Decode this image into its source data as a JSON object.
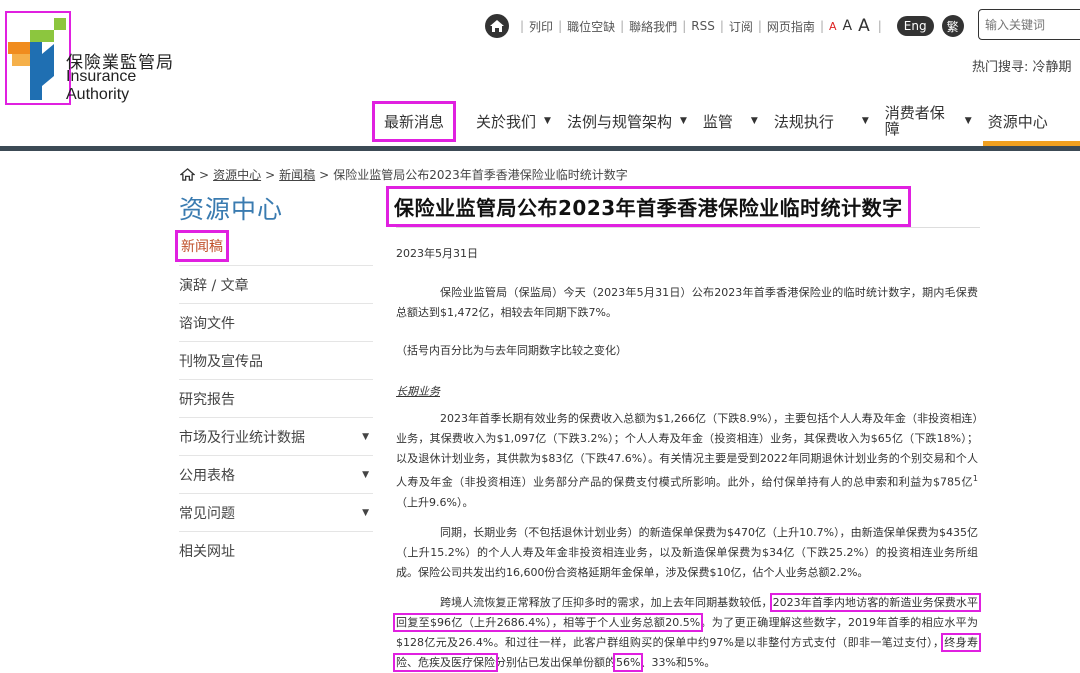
{
  "org": {
    "name_zh": "保險業監管局",
    "name_en": "Insurance Authority"
  },
  "topbar": {
    "links": [
      "列印",
      "職位空缺",
      "聯絡我們",
      "RSS",
      "订阅",
      "网页指南"
    ],
    "font_sizes": [
      "A",
      "A",
      "A"
    ],
    "lang_en": "Eng",
    "lang_trad": "繁",
    "search_placeholder": "输入关键词",
    "hot_search": "热门搜寻: 冷静期"
  },
  "nav": {
    "items": [
      {
        "label": "最新消息",
        "has_dropdown": false
      },
      {
        "label": "关於我们",
        "has_dropdown": true
      },
      {
        "label": "法例与规管架构",
        "has_dropdown": true
      },
      {
        "label": "监管",
        "has_dropdown": true
      },
      {
        "label": "法规执行",
        "has_dropdown": true
      },
      {
        "label": "消费者保障",
        "has_dropdown": true
      },
      {
        "label": "资源中心",
        "has_dropdown": false
      }
    ],
    "active": "资源中心"
  },
  "breadcrumb": {
    "items": [
      "资源中心",
      "新闻稿"
    ],
    "current": "保险业监管局公布2023年首季香港保险业临时统计数字"
  },
  "sidebar": {
    "title": "资源中心",
    "current": "新闻稿",
    "items": [
      {
        "label": "演辞 / 文章",
        "has_dropdown": false
      },
      {
        "label": "谘询文件",
        "has_dropdown": false
      },
      {
        "label": "刊物及宣传品",
        "has_dropdown": false
      },
      {
        "label": "研究报告",
        "has_dropdown": false
      },
      {
        "label": "市场及行业统计数据",
        "has_dropdown": true
      },
      {
        "label": "公用表格",
        "has_dropdown": true
      },
      {
        "label": "常见问题",
        "has_dropdown": true
      },
      {
        "label": "相关网址",
        "has_dropdown": false
      }
    ]
  },
  "article": {
    "title": "保险业监管局公布2023年首季香港保险业临时统计数字",
    "date": "2023年5月31日",
    "p1": "保险业监管局（保监局）今天（2023年5月31日）公布2023年首季香港保险业的临时统计数字，期内毛保费总额达到$1,472亿，相较去年同期下跌7%。",
    "p2": "（括号内百分比为与去年同期数字比较之变化）",
    "section_heading": "长期业务",
    "p3_a": "2023年首季长期有效业务的保费收入总额为$1,266亿（下跌8.9%），主要包括个人人寿及年金（非投资相连）业务，其保费收入为$1,097亿（下跌3.2%）；个人人寿及年金（投资相连）业务，其保费收入为$65亿（下跌18%）；以及退休计划业务，其供款为$83亿（下跌47.6%）。有关情况主要是受到2022年同期退休计划业务的个别交易和个人人寿及年金（非投资相连）业务部分产品的保费支付模式所影响。此外，给付保单持有人的总申索和利益为$785亿",
    "p3_sup": "1",
    "p3_b": "（上升9.6%）。",
    "p4": "同期，长期业务（不包括退休计划业务）的新造保单保费为$470亿（上升10.7%），由新造保单保费为$435亿（上升15.2%）的个人人寿及年金非投资相连业务，以及新造保单保费为$34亿（下跌25.2%）的投资相连业务所组成。保险公司共发出约16,600份合资格延期年金保单，涉及保费$10亿，佔个人业务总额2.2%。",
    "p5_a": "跨境人流恢复正常释放了压抑多时的需求，加上去年同期基数较低，",
    "p5_m1": "2023年首季内地访客的新造业务保费水平回复至$96亿（上升2686.4%），相等于个人业务总额20.5%",
    "p5_b": "。为了更正确理解这些数字，2019年首季的相应水平为$128亿元及26.4%。和过往一样，此客户群组购买的保单中约97%是以非整付方式支付（即非一笔过支付），",
    "p5_m2": "终身寿险、危疾及医疗保险",
    "p5_c": "分别佔已发出保单份额的",
    "p5_m3": "56%",
    "p5_d": "、33%和5%。"
  }
}
